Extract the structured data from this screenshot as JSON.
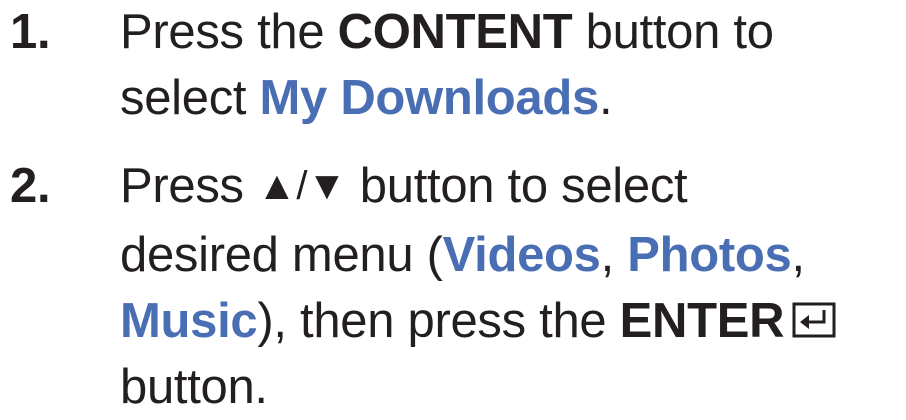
{
  "steps": [
    {
      "number": "1.",
      "text1": "Press the ",
      "bold1": "CONTENT",
      "text2": " button to",
      "text3": "select ",
      "hl1": "My Downloads",
      "text4": "."
    },
    {
      "number": "2.",
      "text1": "Press ",
      "arrows": "▲/▼",
      "text2": " button to select",
      "text3": "desired menu (",
      "hl1": "Videos",
      "text4": ", ",
      "hl2": "Photos",
      "text5": ",",
      "hl3": "Music",
      "text6": "), then press the ",
      "bold1": "ENTER",
      "icon": "enter-icon",
      "text7": "button."
    }
  ]
}
